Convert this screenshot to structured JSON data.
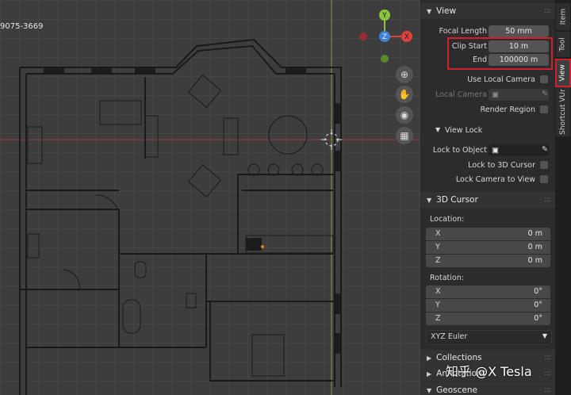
{
  "viewport": {
    "corner_text": "9075-3669",
    "gizmo": {
      "y_label": "Y",
      "z_label": "Z",
      "x_label": "X"
    },
    "nav_icons": [
      "zoom-icon",
      "hand-icon",
      "camera-icon",
      "grid-icon"
    ]
  },
  "panel": {
    "view_header": "View",
    "focal_length_label": "Focal Length",
    "focal_length_value": "50 mm",
    "clip_start_label": "Clip Start",
    "clip_start_value": "10 m",
    "end_label": "End",
    "end_value": "100000 m",
    "use_local_camera_label": "Use Local Camera",
    "local_camera_label": "Local Camera",
    "render_region_label": "Render Region",
    "view_lock_header": "View Lock",
    "lock_to_object_label": "Lock to Object",
    "lock_to_3d_cursor_label": "Lock to 3D Cursor",
    "lock_camera_to_view_label": "Lock Camera to View",
    "cursor_header": "3D Cursor",
    "location_label": "Location:",
    "location": [
      {
        "axis": "X",
        "value": "0 m"
      },
      {
        "axis": "Y",
        "value": "0 m"
      },
      {
        "axis": "Z",
        "value": "0 m"
      }
    ],
    "rotation_label": "Rotation:",
    "rotation": [
      {
        "axis": "X",
        "value": "0°"
      },
      {
        "axis": "Y",
        "value": "0°"
      },
      {
        "axis": "Z",
        "value": "0°"
      }
    ],
    "rotation_mode": "XYZ Euler",
    "collections_header": "Collections",
    "annotations_header": "Annotations",
    "geoscene_header": "Geoscene"
  },
  "tabs": {
    "item": "Item",
    "tool": "Tool",
    "view": "View",
    "shortcut": "Shortcut VUr"
  },
  "watermark": "知乎 @X Tesla",
  "colors": {
    "highlight": "#d0202c",
    "axis_red": "#c8344a",
    "axis_green": "#7fa843",
    "y_gizmo": "#8bc43f",
    "z_gizmo": "#3f7fd8",
    "x_gizmo": "#e0413f"
  }
}
